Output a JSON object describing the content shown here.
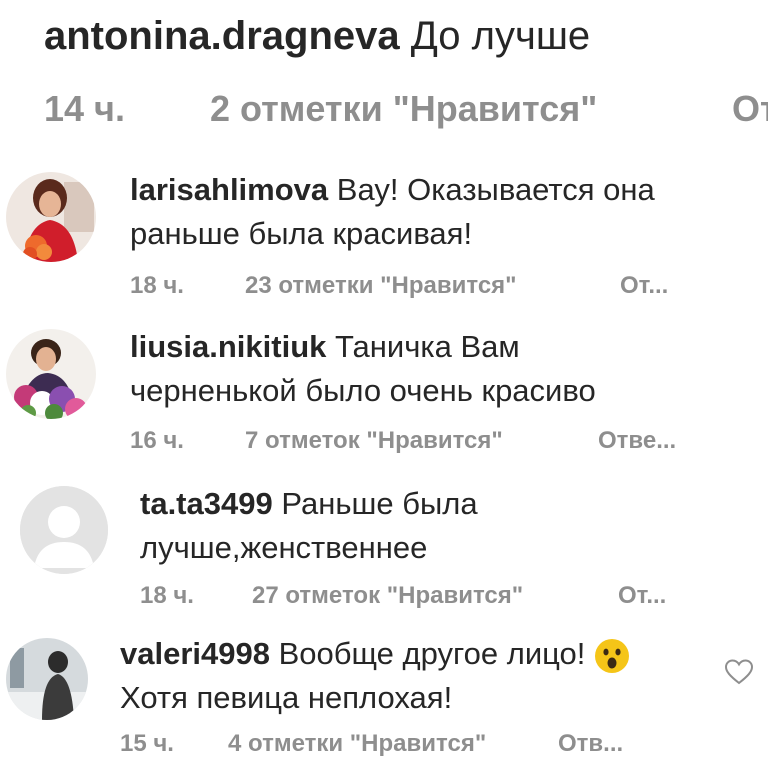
{
  "header_comment": {
    "username": "antonina.dragneva",
    "text": "До лучше",
    "time": "14 ч.",
    "likes": "2 отметки \"Нравится\"",
    "reply": "От"
  },
  "comments": [
    {
      "username": "larisahlimova",
      "text_line1": "Вау! Оказывается она",
      "text_line2": "раньше была красивая!",
      "time": "18 ч.",
      "likes": "23 отметки \"Нравится\"",
      "reply": "От..."
    },
    {
      "username": "liusia.nikitiuk",
      "text_line1": "Таничка Вам",
      "text_line2": "черненькой было очень красиво",
      "time": "16 ч.",
      "likes": "7 отметок \"Нравится\"",
      "reply": "Отве..."
    },
    {
      "username": "ta.ta3499",
      "text_line1": "Раньше была",
      "text_line2": "лучше,женственнее",
      "time": "18 ч.",
      "likes": "27 отметок \"Нравится\"",
      "reply": "От..."
    },
    {
      "username": "valeri4998",
      "text_line1": "Вообще другое лицо!",
      "text_line2": "Хотя певица неплохая!",
      "emoji": "😮",
      "time": "15 ч.",
      "likes": "4 отметки \"Нравится\"",
      "reply": "Отв..."
    }
  ],
  "icons": {
    "like": "heart-outline-icon",
    "default_avatar": "default-avatar-icon"
  },
  "colors": {
    "text": "#262626",
    "meta": "#8e8e8e",
    "emoji": "#f5c518"
  }
}
